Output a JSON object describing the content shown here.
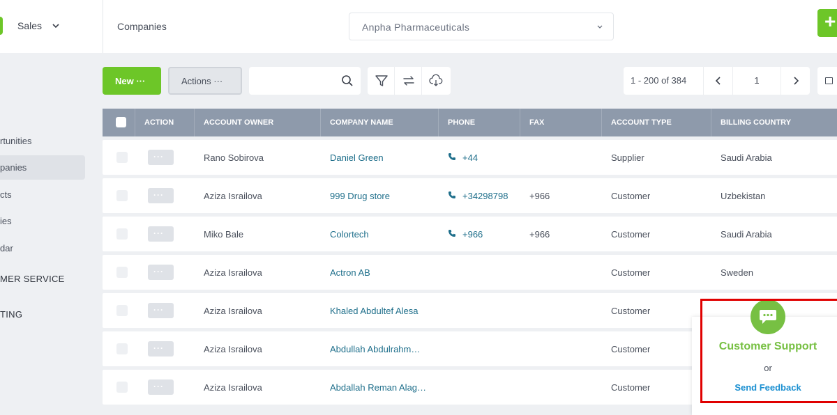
{
  "app": {
    "name": "Sales"
  },
  "header": {
    "breadcrumb": "Companies",
    "company_select": "Anpha Pharmaceuticals",
    "plus_label": "+"
  },
  "sidebar": {
    "items": [
      {
        "label": "rtunities"
      },
      {
        "label": "panies",
        "active": true
      },
      {
        "label": "cts"
      },
      {
        "label": "ies"
      },
      {
        "label": "dar"
      }
    ],
    "sections": [
      {
        "label": "MER SERVICE"
      },
      {
        "label": "TING"
      }
    ]
  },
  "toolbar": {
    "new_label": "New ···",
    "actions_label": "Actions ···",
    "search_placeholder": ""
  },
  "pager": {
    "range": "1 - 200 of 384",
    "page": "1"
  },
  "table": {
    "columns": [
      "ACTION",
      "ACCOUNT OWNER",
      "COMPANY NAME",
      "PHONE",
      "FAX",
      "ACCOUNT TYPE",
      "BILLING COUNTRY"
    ],
    "action_label": "···",
    "rows": [
      {
        "owner": "Rano Sobirova",
        "company": "Daniel Green",
        "phone": "+44",
        "fax": "",
        "type": "Supplier",
        "country": "Saudi Arabia"
      },
      {
        "owner": "Aziza Israilova",
        "company": "999 Drug store",
        "phone": "+34298798",
        "fax": "+966",
        "type": "Customer",
        "country": "Uzbekistan"
      },
      {
        "owner": "Miko Bale",
        "company": "Colortech",
        "phone": "+966",
        "fax": "+966",
        "type": "Customer",
        "country": "Saudi Arabia"
      },
      {
        "owner": "Aziza Israilova",
        "company": "Actron AB",
        "phone": "",
        "fax": "",
        "type": "Customer",
        "country": "Sweden"
      },
      {
        "owner": "Aziza Israilova",
        "company": "Khaled Abdultef Alesa",
        "phone": "",
        "fax": "",
        "type": "Customer",
        "country": ""
      },
      {
        "owner": "Aziza Israilova",
        "company": "Abdullah Abdulrahm…",
        "phone": "",
        "fax": "",
        "type": "Customer",
        "country": ""
      },
      {
        "owner": "Aziza Israilova",
        "company": "Abdallah Reman Alag…",
        "phone": "",
        "fax": "",
        "type": "Customer",
        "country": ""
      }
    ]
  },
  "support": {
    "title": "Customer Support",
    "or": "or",
    "feedback": "Send Feedback"
  },
  "colors": {
    "accent": "#6dc628",
    "header_bg": "#8e9aab",
    "link": "#1f6f8b",
    "highlight": "#e00000"
  }
}
